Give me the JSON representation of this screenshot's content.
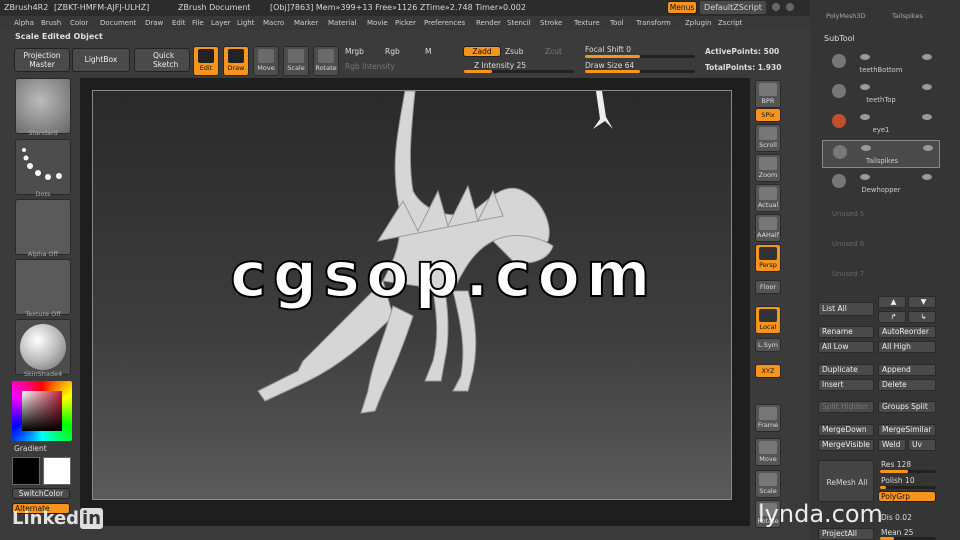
{
  "title_bar": {
    "app": "ZBrush4R2",
    "code": "[ZBKT-HMFM-AJFJ-ULHZ]",
    "doc": "ZBrush Document",
    "stats": "[Obj]7863] Mem»399+13 Free»1126 ZTime»2.748 Timer»0.002",
    "menus_btn": "Menus",
    "script": "DefaultZScript"
  },
  "menu_items": [
    "Alpha",
    "Brush",
    "Color",
    "Document",
    "Draw",
    "Edit",
    "File",
    "Layer",
    "Light",
    "Macro",
    "Marker",
    "Material",
    "Movie",
    "Picker",
    "Preferences",
    "Render",
    "Stencil",
    "Stroke",
    "Texture",
    "Tool",
    "Transform",
    "Zplugin",
    "Zscript"
  ],
  "header_label": "Scale Edited Object",
  "toolbar": {
    "projection_master": "Projection Master",
    "lightbox": "LightBox",
    "quick_sketch": "Quick Sketch",
    "edit": "Edit",
    "draw": "Draw",
    "move": "Move",
    "scale": "Scale",
    "rotate": "Rotate",
    "mrgb": "Mrgb",
    "rgb": "Rgb",
    "m": "M",
    "rgb_intensity": "Rgb Intensity",
    "zadd": "Zadd",
    "zsub": "Zsub",
    "zcut": "Zcut",
    "z_intensity": "Z Intensity 25",
    "focal_shift": "Focal Shift 0",
    "draw_size": "Draw Size 64",
    "active_points": "ActivePoints: 500",
    "total_points": "TotalPoints: 1.930",
    "z_intensity_value": 25,
    "draw_size_value": 64
  },
  "left_shelf": {
    "standard": "Standard",
    "dots": "Dots",
    "alpha_off": "Alpha Off",
    "texture_off": "Texture Off",
    "skin_shade": "SkinShade4",
    "gradient": "Gradient",
    "switch_color": "SwitchColor",
    "alternate": "Alternate"
  },
  "right_shelf": [
    "BPR",
    "SPix",
    "Scroll",
    "Zoom",
    "Actual",
    "AAHalf",
    "Persp",
    "Floor",
    "Local",
    "L.Sym",
    "XYZ",
    "Frame",
    "Move",
    "Scale",
    "Rotate"
  ],
  "subtool": {
    "top_label": "PolyMesh3D",
    "top_label2": "Tailspikes",
    "header": "SubTool",
    "items": [
      {
        "name": "teethBottom"
      },
      {
        "name": "teethTop"
      },
      {
        "name": "eye1"
      },
      {
        "name": "Tailspikes"
      },
      {
        "name": "Dewhopper"
      }
    ],
    "empty": [
      "Unused 5",
      "Unused 6",
      "Unused 7"
    ],
    "list_all": "List All",
    "rename": "Rename",
    "auto_reorder": "AutoReorder",
    "all_low": "All Low",
    "all_high": "All High",
    "duplicate": "Duplicate",
    "append": "Append",
    "insert": "Insert",
    "delete": "Delete",
    "split_hidden": "Split Hidden",
    "groups_split": "Groups Split",
    "merge_down": "MergeDown",
    "merge_similar": "MergeSimilar",
    "merge_visible": "MergeVisible",
    "weld": "Weld",
    "uv": "Uv",
    "remesh_all": "ReMesh All",
    "res": "Res 128",
    "polish": "Polish 10",
    "polygrp": "PolyGrp",
    "dist": "Dis 0.02",
    "project_all": "ProjectAll",
    "mean": "Mean 25",
    "res_value": 128,
    "polish_value": 10,
    "mean_value": 25
  },
  "watermark": "cgsop.com",
  "logo_left": "Linked",
  "logo_left2": "in",
  "logo_right": "lynda.com"
}
